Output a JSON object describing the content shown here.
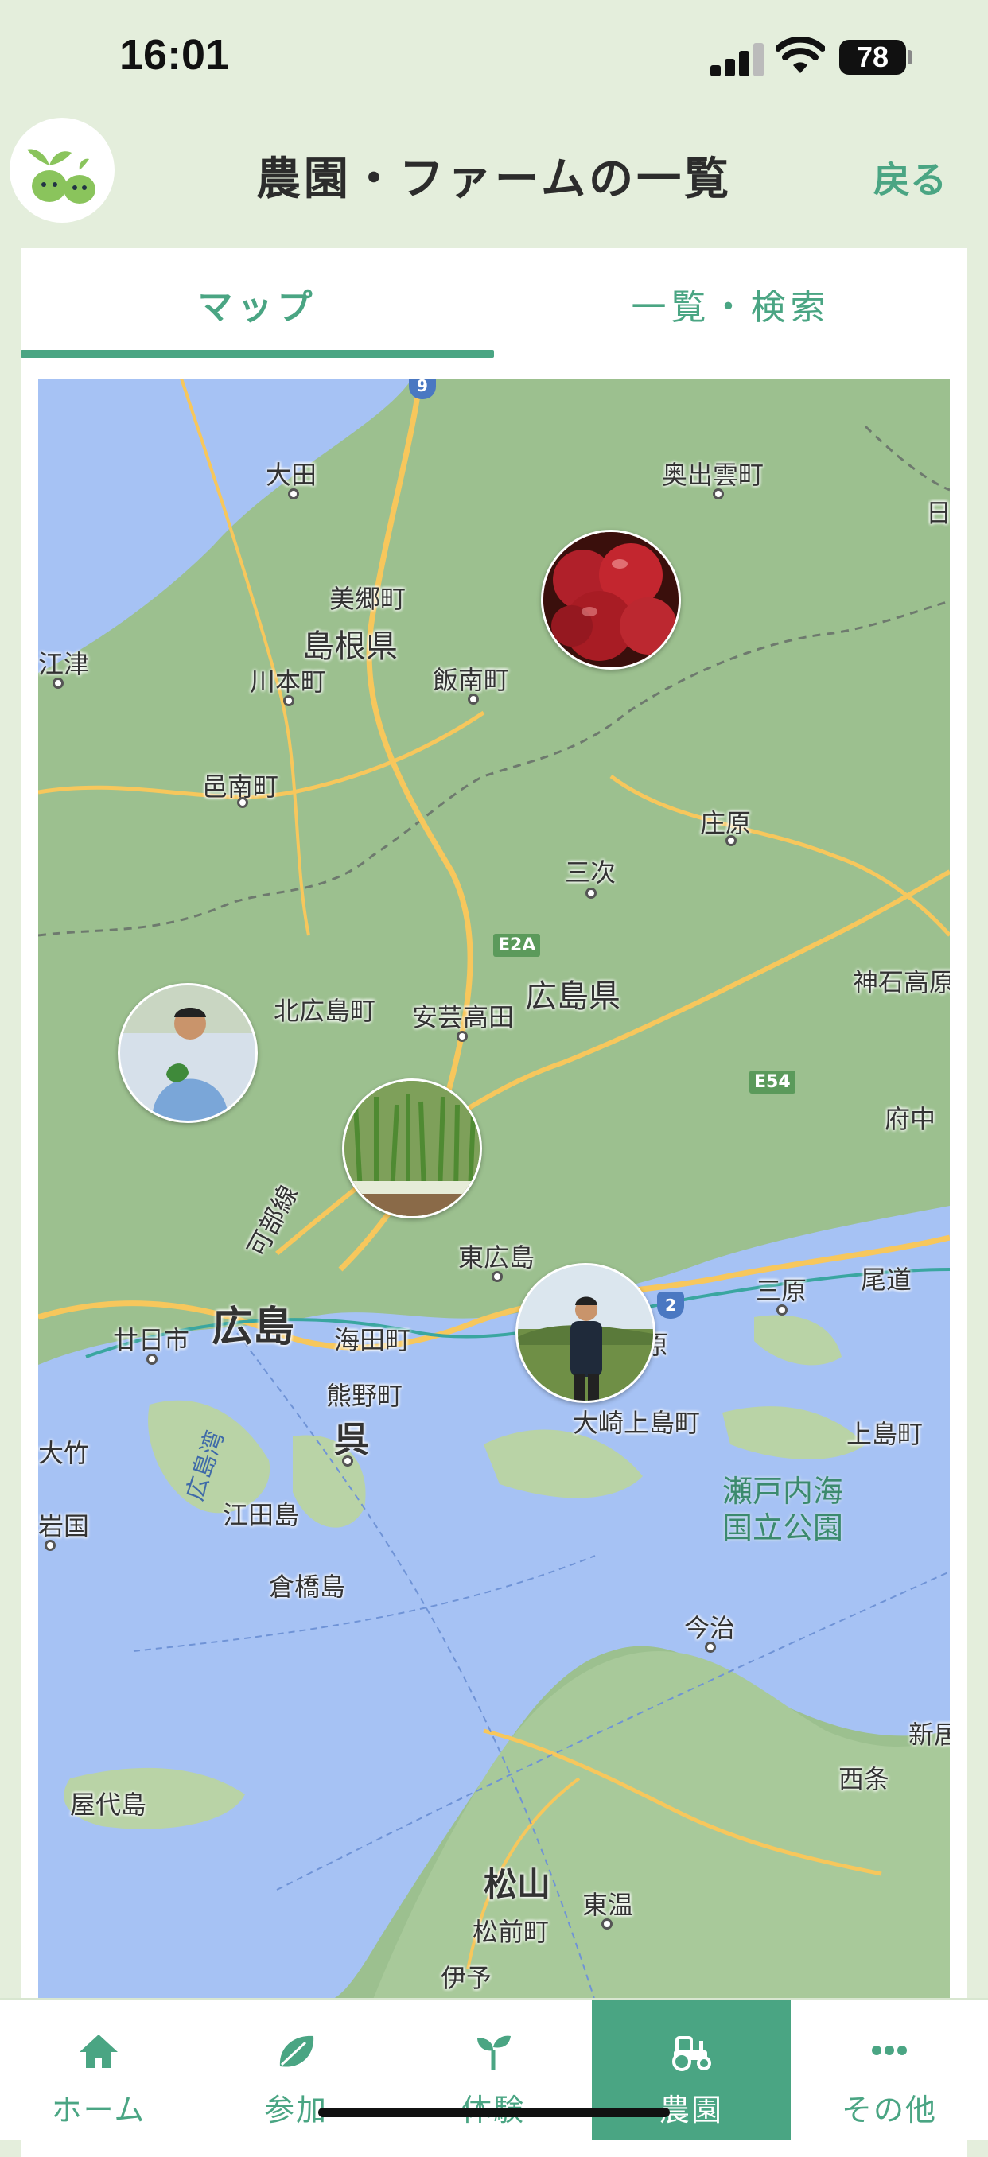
{
  "status": {
    "time": "16:01",
    "battery": "78"
  },
  "header": {
    "title": "農園・ファームの一覧",
    "back": "戻る"
  },
  "tabs": [
    {
      "label": "マップ",
      "active": true
    },
    {
      "label": "一覧・検索",
      "active": false
    }
  ],
  "map": {
    "labels": {
      "oda": "大田",
      "okuizumo": "奥出雲町",
      "hi": "日",
      "misato": "美郷町",
      "shimane": "島根県",
      "gotsu": "江津",
      "kawamoto": "川本町",
      "iinan": "飯南町",
      "ohnan": "邑南町",
      "shobara": "庄原",
      "miyoshi": "三次",
      "hiroshima_pref": "広島県",
      "jinsekikogen": "神石高原",
      "kitahiroshima": "北広島町",
      "akitakata": "安芸高田",
      "fuchu": "府中",
      "kabe": "可部線",
      "higashihiroshima": "東広島",
      "hiroshima": "広島",
      "hatsukaichi": "廿日市",
      "kaita": "海田町",
      "mihara": "三原",
      "onomichi": "尾道",
      "kumano": "熊野町",
      "kure": "呉",
      "osakikamijima": "大崎上島町",
      "kamijima": "上島町",
      "otake": "大竹",
      "iwakuni": "岩国",
      "hiroshimawan": "広島湾",
      "etajima": "江田島",
      "setonaikai": "瀬戸内海",
      "kokuritsu": "国立公園",
      "kurahashi": "倉橋島",
      "imabari": "今治",
      "niihama": "新居",
      "saijo": "西条",
      "yashiro": "屋代島",
      "matsuyama": "松山",
      "toon": "東温",
      "masaki": "松前町",
      "iyo": "伊予",
      "higashi_partial": "原"
    },
    "routes": {
      "e2a": "E2A",
      "e54": "E54",
      "r2": "2",
      "r9": "9"
    },
    "pins": [
      "apple-farm",
      "farmer-greens",
      "green-onion-field",
      "farmer-field"
    ]
  },
  "nav": [
    {
      "label": "ホーム",
      "icon": "home-icon",
      "active": false
    },
    {
      "label": "参加",
      "icon": "leaf-icon",
      "active": false
    },
    {
      "label": "体験",
      "icon": "sprout-icon",
      "active": false
    },
    {
      "label": "農園",
      "icon": "tractor-icon",
      "active": true
    },
    {
      "label": "その他",
      "icon": "more-icon",
      "active": false
    }
  ],
  "colors": {
    "accent": "#4aa583",
    "background": "#e4eedc",
    "land": "#9cc08f",
    "sea": "#a6c2f4",
    "road": "#f7c75c"
  }
}
